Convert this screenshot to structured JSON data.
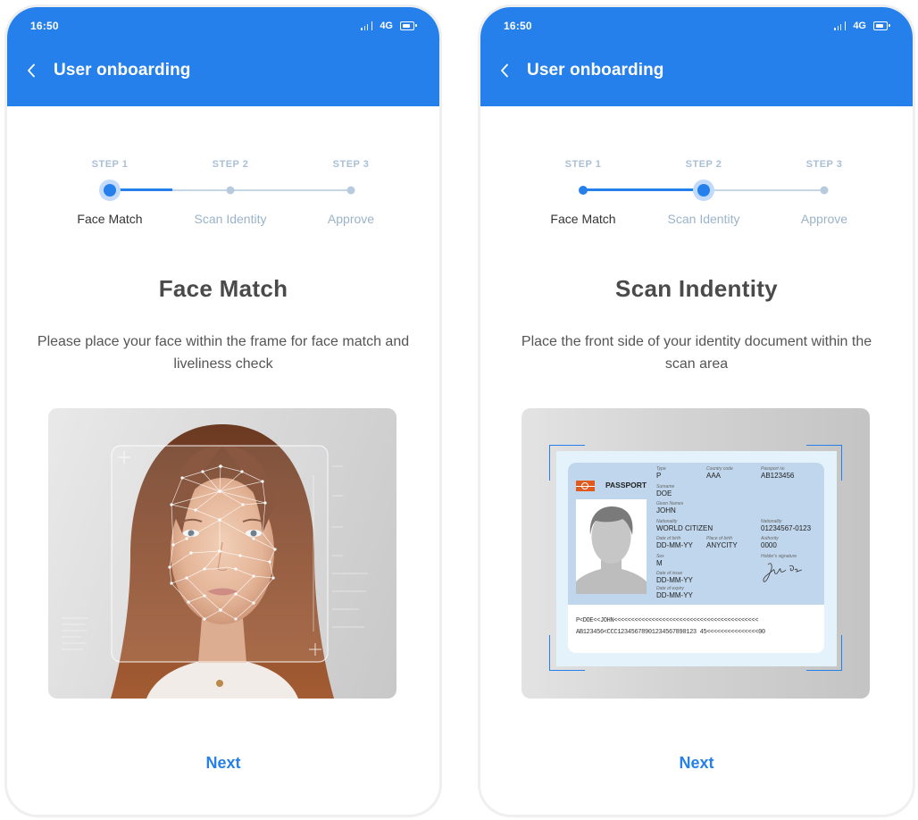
{
  "status_bar": {
    "time": "16:50",
    "network": "4G",
    "signal_icon": "signal-icon",
    "battery_icon": "battery-icon"
  },
  "app_bar": {
    "title": "User onboarding",
    "back_icon": "chevron-left-icon"
  },
  "steps": [
    {
      "label": "STEP 1",
      "name": "Face Match"
    },
    {
      "label": "STEP 2",
      "name": "Scan Identity"
    },
    {
      "label": "STEP 3",
      "name": "Approve"
    }
  ],
  "screens": [
    {
      "current_step": 1,
      "heading": "Face Match",
      "description": "Please place your face within the frame for face match and liveliness check",
      "media": "face-scan-illustration",
      "next_label": "Next"
    },
    {
      "current_step": 2,
      "heading": "Scan Indentity",
      "description": "Place the front side of your identity document within the scan area",
      "media": "passport-scan-illustration",
      "next_label": "Next"
    }
  ],
  "passport": {
    "title": "PASSPORT",
    "fields": {
      "type": {
        "label": "Type",
        "value": "P"
      },
      "country_code": {
        "label": "Country code",
        "value": "AAA"
      },
      "passport_no": {
        "label": "Passport №",
        "value": "AB123456"
      },
      "surname": {
        "label": "Surname",
        "value": "DOE"
      },
      "given_names": {
        "label": "Given Names",
        "value": "JOHN"
      },
      "nationality": {
        "label": "Nationality",
        "value": "WORLD CITIZEN"
      },
      "personal_no": {
        "label": "Nationality",
        "value": "01234567-0123"
      },
      "dob": {
        "label": "Date of birth",
        "value": "DD-MM-YY"
      },
      "pob": {
        "label": "Place of birth",
        "value": "ANYCITY"
      },
      "authority": {
        "label": "Authority",
        "value": "0000"
      },
      "sex": {
        "label": "Sex",
        "value": "M"
      },
      "signature": {
        "label": "Holder's signature",
        "value": "John Doe"
      },
      "doi": {
        "label": "Date of issue",
        "value": "DD-MM-YY"
      },
      "doe": {
        "label": "Date of expiry",
        "value": "DD-MM-YY"
      }
    },
    "mrz_line1": "P<DOE<<JOHN<<<<<<<<<<<<<<<<<<<<<<<<<<<<<<<<<<<<<<<<<<",
    "mrz_line2": "AB123456<CCC12345678901234567890123 45<<<<<<<<<<<<<<<00"
  },
  "colors": {
    "primary": "#2680eb",
    "step_pending": "#b7cade",
    "heading": "#4a4a4a"
  }
}
